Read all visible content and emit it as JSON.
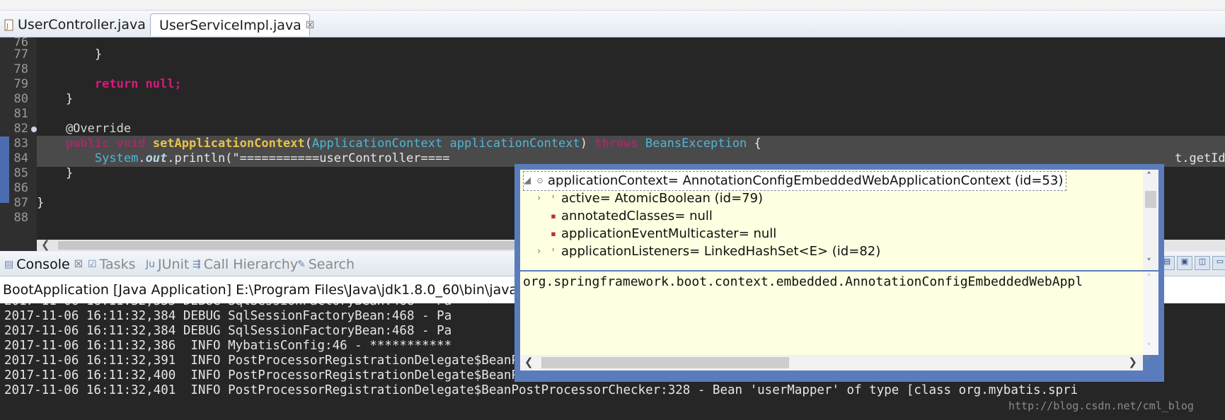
{
  "editor_tabs": [
    {
      "label": "UserController.java",
      "active": false
    },
    {
      "label": "UserServiceImpl.java",
      "active": true,
      "close": "☒"
    }
  ],
  "code": {
    "line_numbers": [
      "76",
      "77",
      "78",
      "79",
      "80",
      "81",
      "82",
      "83",
      "84",
      "85",
      "86",
      "87",
      "88"
    ],
    "lines": {
      "l77": "        }",
      "l79_kw": "return null;",
      "l80": "    }",
      "l82": "    @Override",
      "l83_public": "public",
      "l83_void": "void",
      "l83_method": "setApplicationContext",
      "l83_type": "ApplicationContext",
      "l83_param": "applicationContext",
      "l83_throws": "throws",
      "l83_exc": "BeansException",
      "l83_brace": "{",
      "l84_system": "System",
      "l84_out": "out",
      "l84_rest": "println(\"===========userController====",
      "l84_tail": "t.getId",
      "l85": "    }",
      "l87": "}"
    }
  },
  "view_tabs": [
    {
      "label": "Console",
      "active": true,
      "close": "☒"
    },
    {
      "label": "Tasks",
      "active": false
    },
    {
      "label": "JUnit",
      "active": false
    },
    {
      "label": "Call Hierarchy",
      "active": false
    },
    {
      "label": "Search",
      "active": false
    }
  ],
  "console": {
    "header": "BootApplication [Java Application] E:\\Program Files\\Java\\jdk1.8.0_60\\bin\\javaw.exe (",
    "lines": [
      "2017-11-06 16:11:32,335 DEBUG SqlSessionFactoryBean:468 - Pa                                                                          ce\\targe",
      "2017-11-06 16:11:32,384 DEBUG SqlSessionFactoryBean:468 - Pa                                                                          ce\\targe",
      "2017-11-06 16:11:32,384 DEBUG SqlSessionFactoryBean:468 - Pa                                                                          ce\\targe",
      "2017-11-06 16:11:32,386  INFO MybatisConfig:46 - ***********                                                                          DefaultS",
      "2017-11-06 16:11:32,391  INFO PostProcessorRegistrationDelegate$BeanPostProcessorChecker:328 - Bean 'sqlSessionFactory' of type [class org.apach",
      "2017-11-06 16:11:32,400  INFO PostProcessorRegistrationDelegate$BeanPostProcessorChecker:328 - Bean 'logMapper' of type [class org.mybatis.sprin",
      "2017-11-06 16:11:32,401  INFO PostProcessorRegistrationDelegate$BeanPostProcessorChecker:328 - Bean 'userMapper' of type [class org.mybatis.spri"
    ],
    "watermark": "http://blog.csdn.net/cml_blog"
  },
  "popup": {
    "tree": [
      {
        "label": "applicationContext= AnnotationConfigEmbeddedWebApplicationContext  (id=53)",
        "expand": "◢",
        "icon": "⊙"
      },
      {
        "label": "active= AtomicBoolean  (id=79)",
        "expand": "›",
        "icon": "ᶠ"
      },
      {
        "label": "annotatedClasses= null",
        "expand": "",
        "icon": "▪"
      },
      {
        "label": "applicationEventMulticaster= null",
        "expand": "",
        "icon": "▪"
      },
      {
        "label": "applicationListeners= LinkedHashSet<E>  (id=82)",
        "expand": "›",
        "icon": "ᶠ"
      }
    ],
    "detail": "org.springframework.boot.context.embedded.AnnotationConfigEmbeddedWebAppl"
  }
}
